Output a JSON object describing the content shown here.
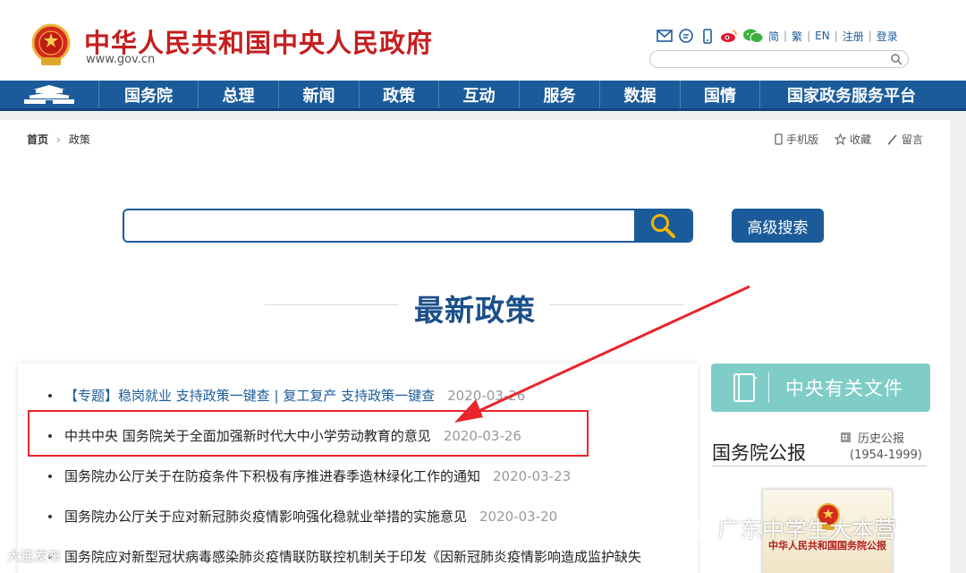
{
  "header": {
    "site_title": "中华人民共和国中央人民政府",
    "site_url": "www.gov.cn",
    "lang_links": [
      "简",
      "繁",
      "EN",
      "注册",
      "登录"
    ],
    "tool_icons": [
      "email-icon",
      "message-icon",
      "mobile-icon",
      "weibo-icon",
      "wechat-icon"
    ],
    "search_placeholder": ""
  },
  "nav": {
    "home_icon": "tiananmen-icon",
    "items": [
      "国务院",
      "总理",
      "新闻",
      "政策",
      "互动",
      "服务",
      "数据",
      "国情",
      "国家政务服务平台"
    ]
  },
  "breadcrumb": {
    "home": "首页",
    "current": "政策"
  },
  "page_tools": {
    "mobile": "手机版",
    "favorite": "收藏",
    "message": "留言"
  },
  "search": {
    "placeholder": "",
    "advanced_label": "高级搜索"
  },
  "section": {
    "title": "最新政策"
  },
  "policies": [
    {
      "title": "【专题】稳岗就业 支持政策一键查 | 复工复产 支持政策一键查",
      "date": "2020-03-26"
    },
    {
      "title": "中共中央 国务院关于全面加强新时代大中小学劳动教育的意见",
      "date": "2020-03-26"
    },
    {
      "title": "国务院办公厅关于在防疫条件下积极有序推进春季造林绿化工作的通知",
      "date": "2020-03-23"
    },
    {
      "title": "国务院办公厅关于应对新冠肺炎疫情影响强化稳就业举措的实施意见",
      "date": "2020-03-20"
    },
    {
      "title": "国务院应对新型冠状病毒感染肺炎疫情联防联控机制关于印发《因新冠肺炎疫情影响造成监护缺失",
      "date": ""
    }
  ],
  "sidebar": {
    "banner_label": "中央有关文件",
    "gazette_title": "国务院公报",
    "history_label": "历史公报",
    "history_range": "(1954-1999)",
    "cover_text": "中华人民共和国国务院公报"
  },
  "overlays": {
    "watermark": "广东中学生大本营",
    "watermark_bottom": "大连发布"
  },
  "colors": {
    "brand_red": "#c41f20",
    "nav_blue": "#1b5b9a",
    "teal": "#7fcdc6",
    "annotation_red": "#e8262c"
  }
}
